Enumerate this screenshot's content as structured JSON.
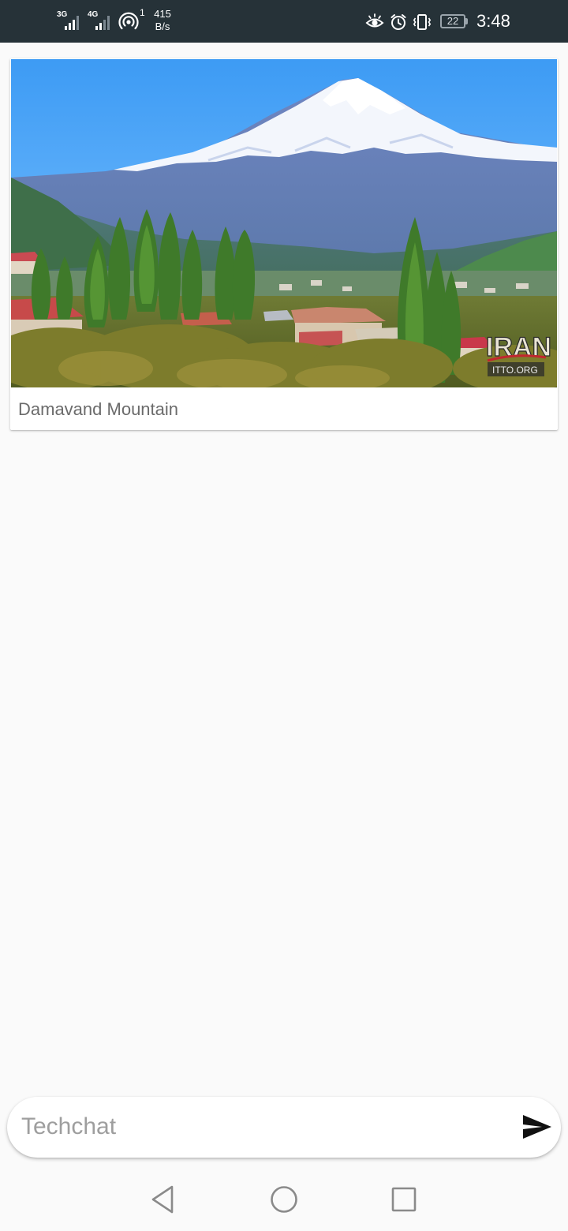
{
  "status_bar": {
    "network_1": "3G",
    "network_2": "4G",
    "hotspot_count": "1",
    "speed_value": "415",
    "speed_unit": "B/s",
    "battery": "22",
    "time": "3:48",
    "icons": [
      "signal-3g-icon",
      "signal-4g-icon",
      "hotspot-icon",
      "eye-comfort-icon",
      "alarm-icon",
      "vibrate-icon",
      "battery-icon"
    ]
  },
  "post": {
    "image_alt": "Damavand Mountain",
    "watermark_brand": "IRAN",
    "watermark_site": "ITTO.ORG",
    "caption": "Damavand Mountain"
  },
  "composer": {
    "placeholder": "Techchat",
    "value": "",
    "send_icon": "send-icon"
  },
  "nav": {
    "icons": [
      "back-icon",
      "home-icon",
      "recents-icon"
    ]
  },
  "colors": {
    "status_bar_bg": "#263238",
    "page_bg": "#fafafa",
    "caption_text": "#6b6b6b",
    "placeholder_text": "#9e9e9e",
    "send_icon": "#111111"
  }
}
